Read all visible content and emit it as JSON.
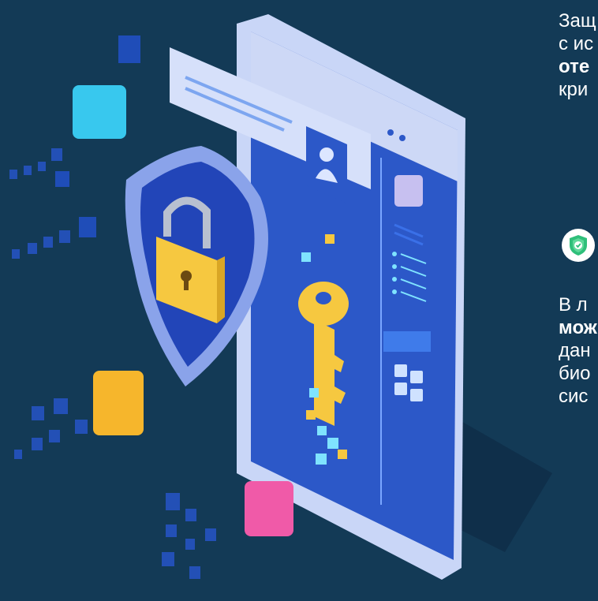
{
  "paragraph_1": {
    "lines": [
      {
        "text": "Защ",
        "bold": false
      },
      {
        "text": "с ис",
        "bold": false
      },
      {
        "text": "оте",
        "bold": true
      },
      {
        "text": "кри",
        "bold": false
      }
    ]
  },
  "paragraph_2": {
    "lines": [
      {
        "text": "В л",
        "bold": false
      },
      {
        "text": "мож",
        "bold": true
      },
      {
        "text": "дан",
        "bold": false
      },
      {
        "text": "био",
        "bold": false
      },
      {
        "text": "сис",
        "bold": false
      }
    ]
  },
  "colors": {
    "background": "#133a56",
    "phone_body": "#2c58c8",
    "shield_badge": "#2fbf7a",
    "lock_key": "#f6c840"
  },
  "icons": [
    "shield-check-icon",
    "padlock-icon",
    "key-icon",
    "user-icon"
  ]
}
